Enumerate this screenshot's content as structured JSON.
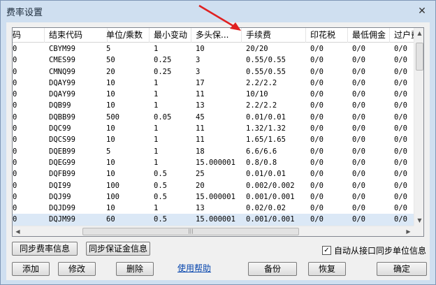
{
  "window": {
    "title": "费率设置",
    "close_glyph": "✕"
  },
  "grid": {
    "columns": [
      "码",
      "结束代码",
      "单位/乘数",
      "最小变动",
      "多头保...",
      "手续费",
      "印花税",
      "最低佣金",
      "过户费"
    ],
    "rows": [
      {
        "c0": "0",
        "code": "CBYM99",
        "unit": "5",
        "tick": "1",
        "margin": "10",
        "fee": "20/20",
        "stamp": "0/0",
        "mincomm": "0/0",
        "transfer": "0/0"
      },
      {
        "c0": "0",
        "code": "CMES99",
        "unit": "50",
        "tick": "0.25",
        "margin": "3",
        "fee": "0.55/0.55",
        "stamp": "0/0",
        "mincomm": "0/0",
        "transfer": "0/0"
      },
      {
        "c0": "0",
        "code": "CMNQ99",
        "unit": "20",
        "tick": "0.25",
        "margin": "3",
        "fee": "0.55/0.55",
        "stamp": "0/0",
        "mincomm": "0/0",
        "transfer": "0/0"
      },
      {
        "c0": "0",
        "code": "DQAY99",
        "unit": "10",
        "tick": "1",
        "margin": "17",
        "fee": "2.2/2.2",
        "stamp": "0/0",
        "mincomm": "0/0",
        "transfer": "0/0"
      },
      {
        "c0": "0",
        "code": "DQAY99",
        "unit": "10",
        "tick": "1",
        "margin": "11",
        "fee": "10/10",
        "stamp": "0/0",
        "mincomm": "0/0",
        "transfer": "0/0"
      },
      {
        "c0": "0",
        "code": "DQB99",
        "unit": "10",
        "tick": "1",
        "margin": "13",
        "fee": "2.2/2.2",
        "stamp": "0/0",
        "mincomm": "0/0",
        "transfer": "0/0"
      },
      {
        "c0": "0",
        "code": "DQBB99",
        "unit": "500",
        "tick": "0.05",
        "margin": "45",
        "fee": "0.01/0.01",
        "stamp": "0/0",
        "mincomm": "0/0",
        "transfer": "0/0"
      },
      {
        "c0": "0",
        "code": "DQC99",
        "unit": "10",
        "tick": "1",
        "margin": "11",
        "fee": "1.32/1.32",
        "stamp": "0/0",
        "mincomm": "0/0",
        "transfer": "0/0"
      },
      {
        "c0": "0",
        "code": "DQCS99",
        "unit": "10",
        "tick": "1",
        "margin": "11",
        "fee": "1.65/1.65",
        "stamp": "0/0",
        "mincomm": "0/0",
        "transfer": "0/0"
      },
      {
        "c0": "0",
        "code": "DQEB99",
        "unit": "5",
        "tick": "1",
        "margin": "18",
        "fee": "6.6/6.6",
        "stamp": "0/0",
        "mincomm": "0/0",
        "transfer": "0/0"
      },
      {
        "c0": "0",
        "code": "DQEG99",
        "unit": "10",
        "tick": "1",
        "margin": "15.000001",
        "fee": "0.8/0.8",
        "stamp": "0/0",
        "mincomm": "0/0",
        "transfer": "0/0"
      },
      {
        "c0": "0",
        "code": "DQFB99",
        "unit": "10",
        "tick": "0.5",
        "margin": "25",
        "fee": "0.01/0.01",
        "stamp": "0/0",
        "mincomm": "0/0",
        "transfer": "0/0"
      },
      {
        "c0": "0",
        "code": "DQI99",
        "unit": "100",
        "tick": "0.5",
        "margin": "20",
        "fee": "0.002/0.002",
        "stamp": "0/0",
        "mincomm": "0/0",
        "transfer": "0/0"
      },
      {
        "c0": "0",
        "code": "DQJ99",
        "unit": "100",
        "tick": "0.5",
        "margin": "15.000001",
        "fee": "0.001/0.001",
        "stamp": "0/0",
        "mincomm": "0/0",
        "transfer": "0/0"
      },
      {
        "c0": "0",
        "code": "DQJD99",
        "unit": "10",
        "tick": "1",
        "margin": "13",
        "fee": "0.02/0.02",
        "stamp": "0/0",
        "mincomm": "0/0",
        "transfer": "0/0"
      },
      {
        "c0": "0",
        "code": "DQJM99",
        "unit": "60",
        "tick": "0.5",
        "margin": "15.000001",
        "fee": "0.001/0.001",
        "stamp": "0/0",
        "mincomm": "0/0",
        "transfer": "0/0"
      }
    ],
    "scroll_thumb_glyph": "|||"
  },
  "buttons": {
    "sync_fee": "同步费率信息",
    "sync_margin": "同步保证金信息",
    "add": "添加",
    "edit": "修改",
    "delete": "删除",
    "backup": "备份",
    "restore": "恢复",
    "ok": "确定"
  },
  "help_link": "使用帮助",
  "auto_sync": {
    "label": "自动从接口同步单位信息",
    "checked": true,
    "check_glyph": "✓"
  },
  "colors": {
    "annotation_arrow": "#e02020",
    "link": "#0645ad",
    "selected_row": "#dbe8f6"
  },
  "icons": [
    "close-icon",
    "scroll-up-icon",
    "scroll-down-icon",
    "scroll-left-icon",
    "scroll-right-icon",
    "arrow-annotation-icon"
  ]
}
